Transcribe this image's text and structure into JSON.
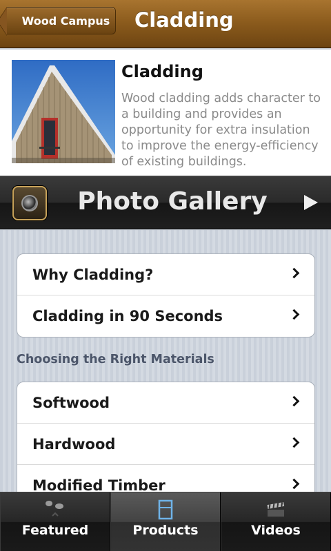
{
  "header": {
    "back_label": "Wood Campus",
    "title": "Cladding"
  },
  "intro": {
    "heading": "Cladding",
    "description": "Wood cladding adds character to a building and provides an opportunity for extra insulation to improve the energy-efficiency of existing buildings."
  },
  "gallery": {
    "label": "Photo Gallery",
    "icon": "camera-icon",
    "play_icon": "play-icon"
  },
  "group1": {
    "items": [
      {
        "label": "Why Cladding?"
      },
      {
        "label": "Cladding in 90 Seconds"
      }
    ]
  },
  "section": {
    "heading": "Choosing the Right Materials"
  },
  "group2": {
    "items": [
      {
        "label": "Softwood"
      },
      {
        "label": "Hardwood"
      },
      {
        "label": "Modified Timber"
      }
    ]
  },
  "tabs": [
    {
      "label": "Featured",
      "icon": "featured-icon",
      "active": false
    },
    {
      "label": "Products",
      "icon": "products-icon",
      "active": true
    },
    {
      "label": "Videos",
      "icon": "videos-icon",
      "active": false
    }
  ],
  "colors": {
    "header_brown": "#8a5a1c",
    "section_heading": "#4c566a",
    "products_icon_blue": "#6fb3e8"
  }
}
